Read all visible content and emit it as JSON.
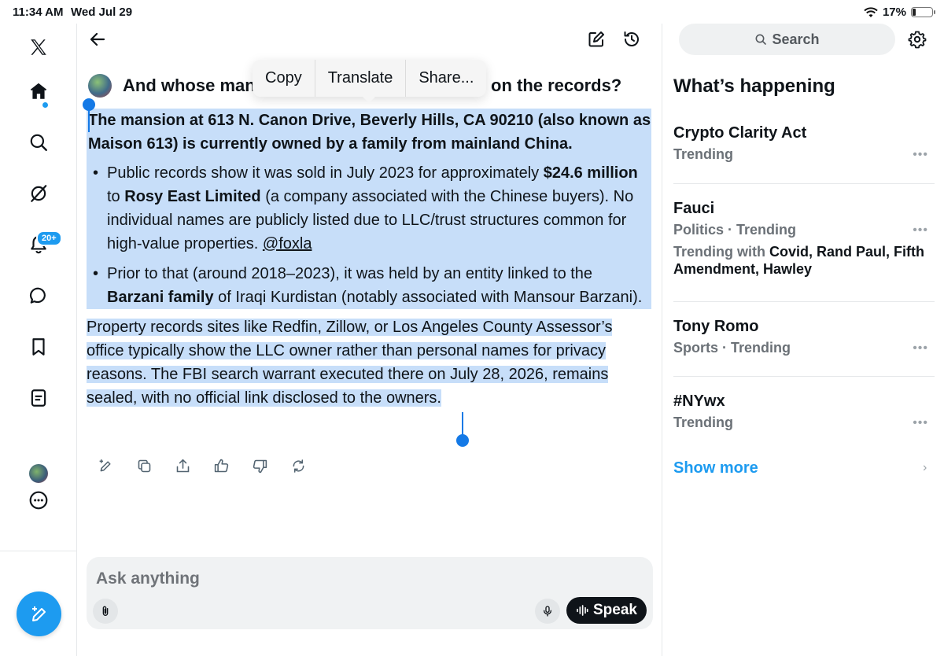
{
  "status_bar": {
    "time": "11:34 AM",
    "date": "Wed Jul 29",
    "battery_percent": "17%",
    "battery_level": 0.17
  },
  "nav": {
    "items": [
      "x-logo",
      "home",
      "search",
      "grok",
      "notifications",
      "messages",
      "bookmarks",
      "lists",
      "profile",
      "more"
    ],
    "notifications_badge": "20+"
  },
  "header": {
    "back": "back",
    "edit": "edit",
    "history": "history"
  },
  "question": {
    "start": "And whose man",
    "end": "on the records?"
  },
  "context_menu": {
    "copy": "Copy",
    "translate": "Translate",
    "share": "Share..."
  },
  "answer": {
    "lead": "The mansion at 613 N. Canon Drive, Beverly Hills, CA 90210 (also known as Maison 613) is currently owned by a family from mainland China.",
    "bullet1": {
      "t1": "Public records show it was sold in July 2023 for approximately ",
      "b1": "$24.6 million",
      "t2": " to ",
      "b2": "Rosy East Limited",
      "t3": " (a company associated with the Chinese buyers). No individual names are publicly listed due to LLC/trust structures common for high-value properties. ",
      "link": "@foxla"
    },
    "bullet2": {
      "t1": "Prior to that (around 2018–2023), it was held by an entity linked to the ",
      "b1": "Barzani family",
      "t2": " of Iraqi Kurdistan (notably associated with Mansour Barzani)."
    },
    "final": "Property records sites like Redfin, Zillow, or Los Angeles County Assessor’s office typically show the LLC owner rather than personal names for privacy reasons. The FBI search warrant executed there on July 28, 2026, remains sealed, with no official link disclosed to the owners."
  },
  "actions": [
    "regenerate-edit",
    "copy",
    "share",
    "like",
    "dislike",
    "refresh"
  ],
  "composer": {
    "placeholder": "Ask anything",
    "speak_label": "Speak"
  },
  "right": {
    "search_label": "Search",
    "heading": "What’s happening",
    "trends": [
      {
        "title": "Crypto Clarity Act",
        "meta": "Trending"
      },
      {
        "title": "Fauci",
        "meta": "Politics · Trending",
        "with_label": "Trending with ",
        "with_terms": "Covid, Rand Paul, Fifth Amendment, Hawley"
      },
      {
        "title": "Tony Romo",
        "meta": "Sports · Trending"
      },
      {
        "title": "#NYwx",
        "meta": "Trending"
      }
    ],
    "show_more": "Show more"
  },
  "colors": {
    "accent": "#1d9bf0",
    "selection": "#c7def9",
    "text": "#0f1419",
    "muted": "#6b7177"
  }
}
